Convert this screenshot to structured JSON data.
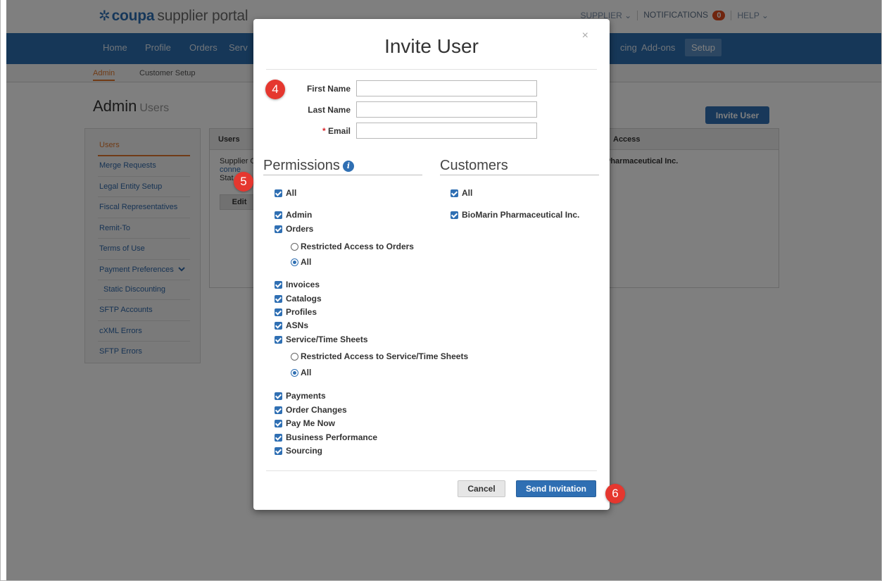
{
  "header": {
    "logo_brand": "coupa",
    "logo_rest": "supplier portal",
    "supplier_menu": "SUPPLIER ⌄",
    "notifications_label": "NOTIFICATIONS",
    "notifications_count": "0",
    "help_menu": "HELP ⌄"
  },
  "nav": {
    "items": [
      "Home",
      "Profile",
      "Orders",
      "Serv",
      "cing",
      "Add-ons",
      "Setup"
    ]
  },
  "subnav": {
    "admin": "Admin",
    "customer_setup": "Customer Setup"
  },
  "page": {
    "title": "Admin",
    "subtitle": "Users",
    "invite_button": "Invite User"
  },
  "sidebar": {
    "items": [
      "Users",
      "Merge Requests",
      "Legal Entity Setup",
      "Fiscal Representatives",
      "Remit-To",
      "Terms of Use",
      "Payment Preferences",
      "Static Discounting",
      "SFTP Accounts",
      "cXML Errors",
      "SFTP Errors"
    ]
  },
  "panel": {
    "col_users": "Users",
    "col_access": "Access",
    "row_text1": "Supplier C",
    "row_link": "conne",
    "row_text3": "Stat",
    "access_value": "Pharmaceutical Inc.",
    "edit_button": "Edit"
  },
  "modal": {
    "title": "Invite User",
    "close": "×",
    "first_name_label": "First Name",
    "last_name_label": "Last Name",
    "email_required": "*",
    "email_label": "Email",
    "first_name_value": "",
    "last_name_value": "",
    "email_value": "",
    "permissions_heading": "Permissions",
    "info_glyph": "i",
    "customers_heading": "Customers",
    "permissions": {
      "all": "All",
      "admin": "Admin",
      "orders": "Orders",
      "orders_restricted": "Restricted Access to Orders",
      "orders_all": "All",
      "invoices": "Invoices",
      "catalogs": "Catalogs",
      "profiles": "Profiles",
      "asns": "ASNs",
      "service_time_sheets": "Service/Time Sheets",
      "sts_restricted": "Restricted Access to Service/Time Sheets",
      "sts_all": "All",
      "payments": "Payments",
      "order_changes": "Order Changes",
      "pay_me_now": "Pay Me Now",
      "business_performance": "Business Performance",
      "sourcing": "Sourcing"
    },
    "customers": {
      "all": "All",
      "biomarin": "BioMarin Pharmaceutical Inc."
    },
    "cancel_button": "Cancel",
    "send_button": "Send Invitation"
  },
  "steps": {
    "step4": "4",
    "step5": "5",
    "step6": "6"
  }
}
